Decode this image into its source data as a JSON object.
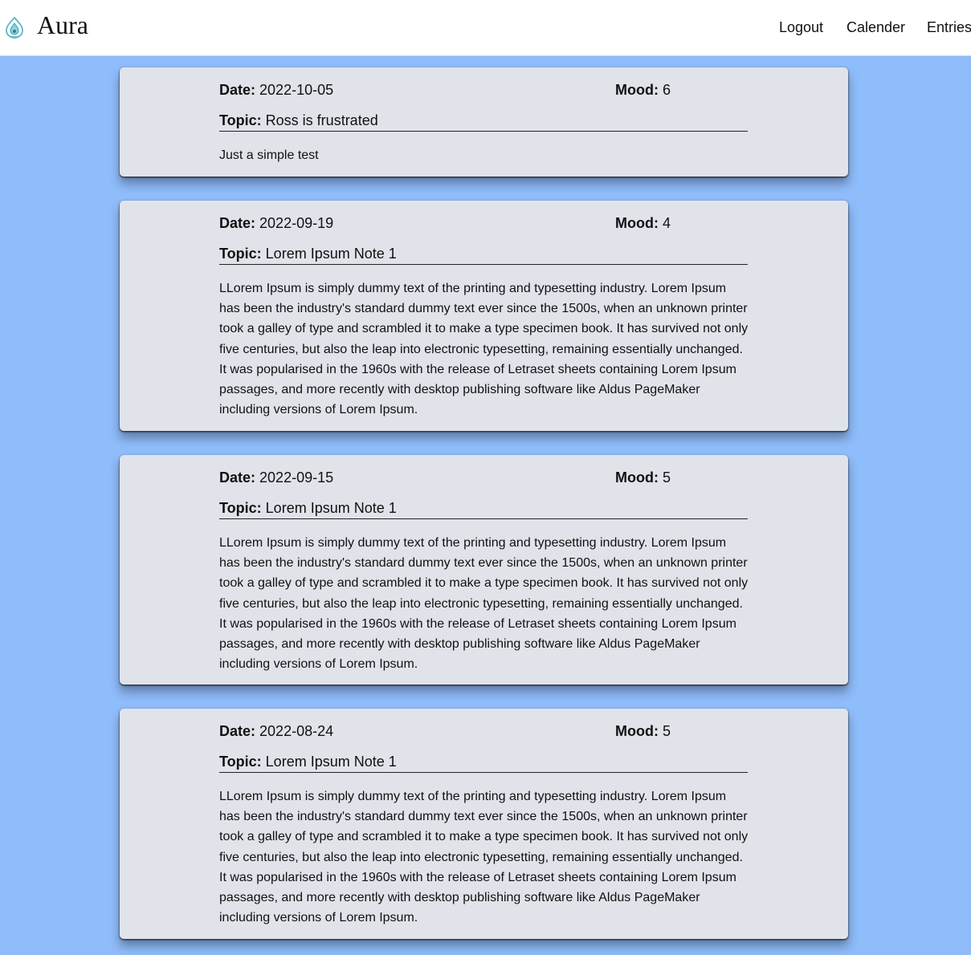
{
  "app": {
    "brand": "Aura",
    "logo_icon": "aura-logo-icon"
  },
  "nav": {
    "logout": "Logout",
    "calender": "Calender",
    "entries": "Entries"
  },
  "labels": {
    "date": "Date:",
    "mood": "Mood:",
    "topic": "Topic:"
  },
  "colors": {
    "background": "#8fbcfa",
    "card": "#e1e3ea",
    "navbar": "#ffffff"
  },
  "entries": [
    {
      "date": "2022-10-05",
      "mood": "6",
      "topic": "Ross is frustrated",
      "body": "Just a simple test"
    },
    {
      "date": "2022-09-19",
      "mood": "4",
      "topic": "Lorem Ipsum Note 1",
      "body": "LLorem Ipsum is simply dummy text of the printing and typesetting industry. Lorem Ipsum has been the industry's standard dummy text ever since the 1500s, when an unknown printer took a galley of type and scrambled it to make a type specimen book. It has survived not only five centuries, but also the leap into electronic typesetting, remaining essentially unchanged. It was popularised in the 1960s with the release of Letraset sheets containing Lorem Ipsum passages, and more recently with desktop publishing software like Aldus PageMaker including versions of Lorem Ipsum."
    },
    {
      "date": "2022-09-15",
      "mood": "5",
      "topic": "Lorem Ipsum Note 1",
      "body": "LLorem Ipsum is simply dummy text of the printing and typesetting industry. Lorem Ipsum has been the industry's standard dummy text ever since the 1500s, when an unknown printer took a galley of type and scrambled it to make a type specimen book. It has survived not only five centuries, but also the leap into electronic typesetting, remaining essentially unchanged. It was popularised in the 1960s with the release of Letraset sheets containing Lorem Ipsum passages, and more recently with desktop publishing software like Aldus PageMaker including versions of Lorem Ipsum."
    },
    {
      "date": "2022-08-24",
      "mood": "5",
      "topic": "Lorem Ipsum Note 1",
      "body": "LLorem Ipsum is simply dummy text of the printing and typesetting industry. Lorem Ipsum has been the industry's standard dummy text ever since the 1500s, when an unknown printer took a galley of type and scrambled it to make a type specimen book. It has survived not only five centuries, but also the leap into electronic typesetting, remaining essentially unchanged. It was popularised in the 1960s with the release of Letraset sheets containing Lorem Ipsum passages, and more recently with desktop publishing software like Aldus PageMaker including versions of Lorem Ipsum."
    }
  ]
}
